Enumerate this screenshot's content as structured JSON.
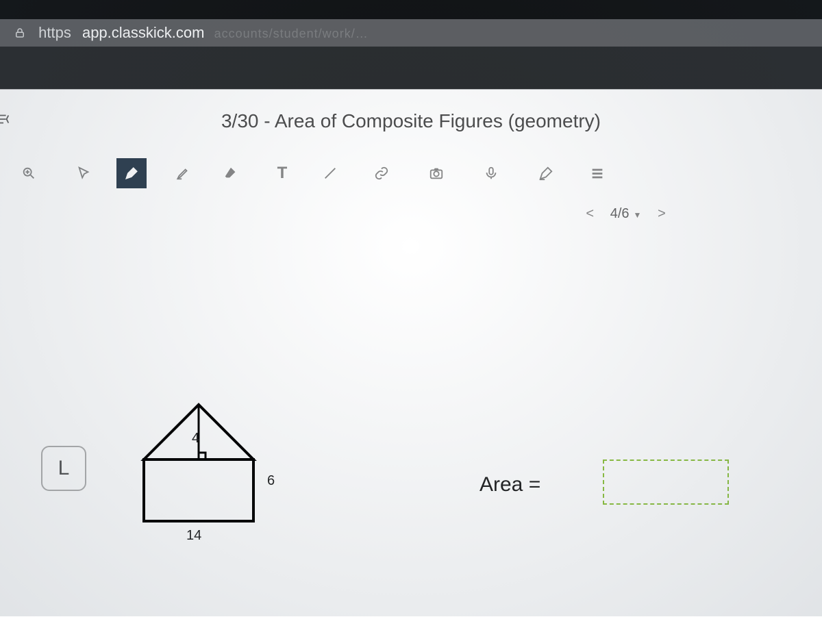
{
  "browser": {
    "scheme": "https",
    "host": "app.classkick.com",
    "path_hint": "accounts/student/work/…"
  },
  "assignment": {
    "title": "3/30 - Area of Composite Figures (geometry)"
  },
  "toolbar": {
    "items": [
      {
        "name": "zoom-icon",
        "glyph": "zoom"
      },
      {
        "name": "pointer-icon",
        "glyph": "pointer"
      },
      {
        "name": "pen-icon",
        "glyph": "pen",
        "active": true
      },
      {
        "name": "highlighter-icon",
        "glyph": "highlighter"
      },
      {
        "name": "eraser-icon",
        "glyph": "eraser"
      },
      {
        "name": "text-tool-icon",
        "glyph": "text"
      },
      {
        "name": "line-tool-icon",
        "glyph": "line"
      },
      {
        "name": "link-icon",
        "glyph": "link"
      },
      {
        "name": "camera-icon",
        "glyph": "camera"
      },
      {
        "name": "mic-icon",
        "glyph": "mic"
      },
      {
        "name": "help-icon",
        "glyph": "help"
      },
      {
        "name": "menu-icon",
        "glyph": "menu"
      }
    ]
  },
  "pager": {
    "prev": "<",
    "count": "4/6",
    "next": ">"
  },
  "slide": {
    "letter": "L",
    "dim_triangle_height": "4",
    "dim_rect_height": "6",
    "dim_base": "14",
    "prompt": "Area ="
  }
}
